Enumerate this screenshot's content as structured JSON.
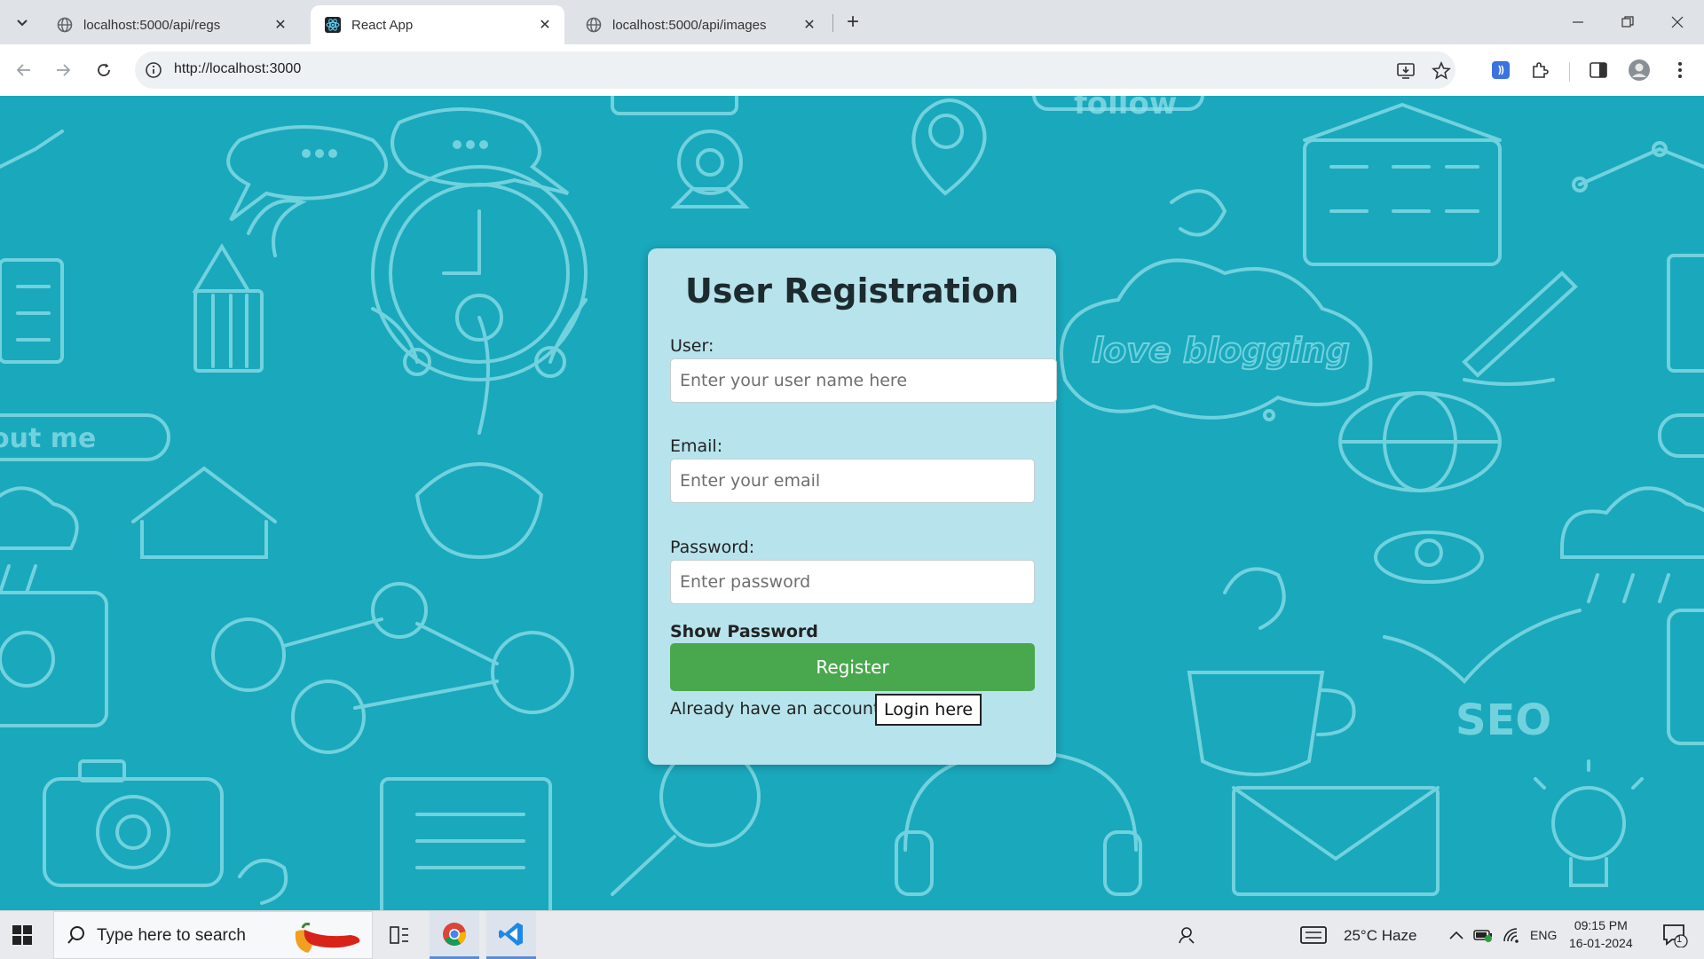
{
  "browser": {
    "tabs": [
      {
        "title": "localhost:5000/api/regs",
        "active": false
      },
      {
        "title": "React App",
        "active": true
      },
      {
        "title": "localhost:5000/api/images",
        "active": false
      }
    ],
    "url": "http://localhost:3000"
  },
  "background": {
    "doodle_texts": [
      "follow",
      "love blogging",
      "out me",
      "SEO"
    ]
  },
  "form": {
    "title": "User Registration",
    "user_label": "User:",
    "user_placeholder": "Enter your user name here",
    "email_label": "Email:",
    "email_placeholder": "Enter your email",
    "password_label": "Password:",
    "password_placeholder": "Enter password",
    "show_password": "Show Password",
    "register_label": "Register",
    "already_text": "Already have an account?",
    "login_label": "Login here"
  },
  "taskbar": {
    "search_placeholder": "Type here to search",
    "weather": "25°C  Haze",
    "language": "ENG",
    "time": "09:15 PM",
    "date": "16-01-2024",
    "notification_count": "1"
  },
  "colors": {
    "page_background": "#1aa8bc",
    "card_background": "#b7e3ec",
    "register_button": "#49a84d"
  }
}
